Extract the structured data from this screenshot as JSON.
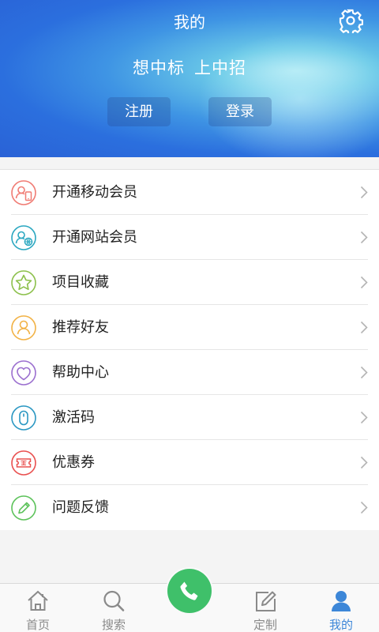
{
  "header": {
    "title": "我的",
    "slogan_left": "想中标",
    "slogan_right": "上中招",
    "register_label": "注册",
    "login_label": "登录"
  },
  "menu": {
    "items": [
      {
        "label": "开通移动会员",
        "icon": "mobile-member-icon",
        "color": "#f07b73"
      },
      {
        "label": "开通网站会员",
        "icon": "web-member-icon",
        "color": "#2aa7c0"
      },
      {
        "label": "项目收藏",
        "icon": "star-icon",
        "color": "#8cc04b"
      },
      {
        "label": "推荐好友",
        "icon": "recommend-friend-icon",
        "color": "#f2b245"
      },
      {
        "label": "帮助中心",
        "icon": "heart-icon",
        "color": "#9b6fcf"
      },
      {
        "label": "激活码",
        "icon": "mouse-icon",
        "color": "#2a97c2"
      },
      {
        "label": "优惠券",
        "icon": "coupon-icon",
        "color": "#e9504f"
      },
      {
        "label": "问题反馈",
        "icon": "pencil-icon",
        "color": "#5cc25a"
      }
    ]
  },
  "tabbar": {
    "tabs": [
      {
        "label": "首页",
        "icon": "home-icon"
      },
      {
        "label": "搜索",
        "icon": "search-icon"
      },
      {
        "label": "",
        "icon": "phone-icon"
      },
      {
        "label": "定制",
        "icon": "edit-icon"
      },
      {
        "label": "我的",
        "icon": "user-icon"
      }
    ],
    "active_tab": "我的",
    "inactive_color": "#8a8a8a",
    "active_color": "#3d87d8",
    "call_color": "#3fc06a"
  }
}
